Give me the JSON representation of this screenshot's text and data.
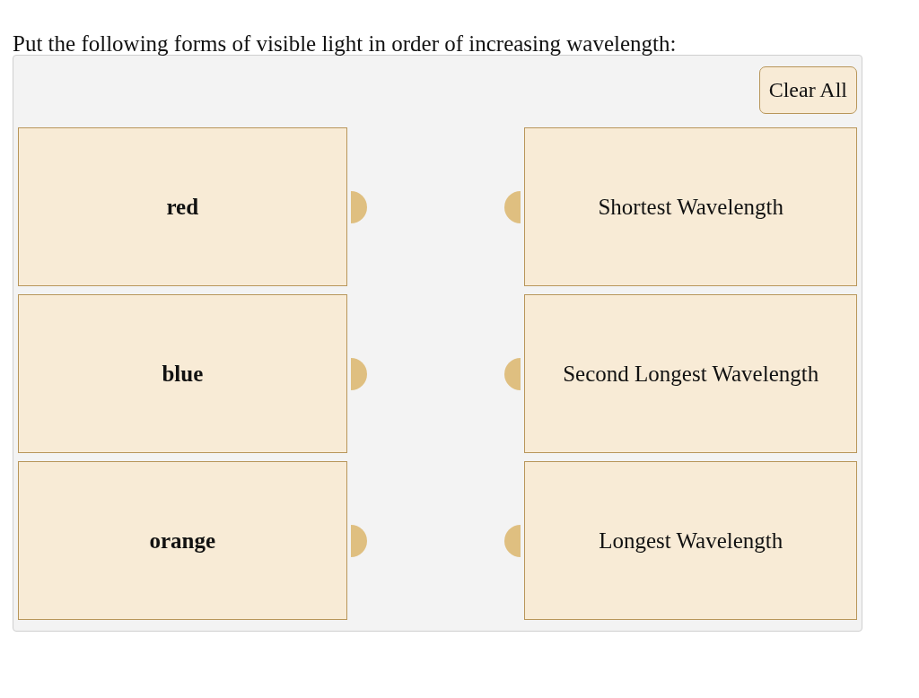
{
  "question": "Put the following forms of visible light in order of increasing wavelength:",
  "clear_button": "Clear All",
  "items": [
    {
      "label": "red"
    },
    {
      "label": "blue"
    },
    {
      "label": "orange"
    }
  ],
  "targets": [
    {
      "label": "Shortest Wavelength"
    },
    {
      "label": "Second Longest Wavelength"
    },
    {
      "label": "Longest Wavelength"
    }
  ]
}
